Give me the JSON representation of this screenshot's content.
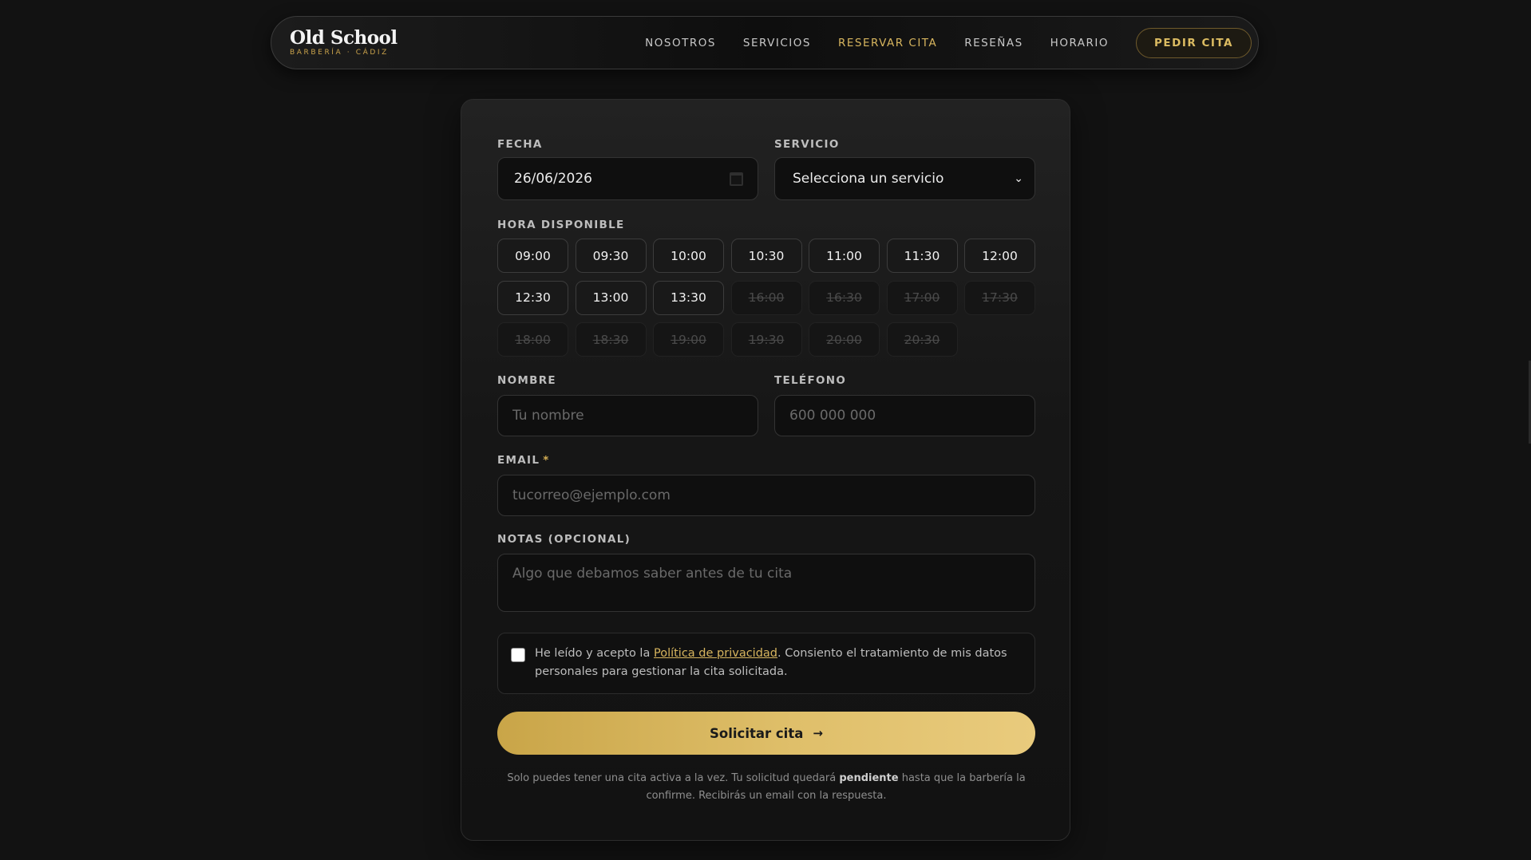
{
  "brand": {
    "name": "Old School",
    "subtitle": "BARBERÍA · CÁDIZ"
  },
  "nav": {
    "links": [
      "NOSOTROS",
      "SERVICIOS",
      "RESERVAR CITA",
      "RESEÑAS",
      "HORARIO"
    ],
    "active": "RESERVAR CITA",
    "cta": "PEDIR CITA"
  },
  "form": {
    "fecha_label": "FECHA",
    "fecha_value": "26/06/2026",
    "servicio_label": "SERVICIO",
    "servicio_value": "Selecciona un servicio",
    "hora_label": "HORA DISPONIBLE",
    "slots": [
      {
        "time": "09:00",
        "available": true
      },
      {
        "time": "09:30",
        "available": true
      },
      {
        "time": "10:00",
        "available": true
      },
      {
        "time": "10:30",
        "available": true
      },
      {
        "time": "11:00",
        "available": true
      },
      {
        "time": "11:30",
        "available": true
      },
      {
        "time": "12:00",
        "available": true
      },
      {
        "time": "12:30",
        "available": true
      },
      {
        "time": "13:00",
        "available": true
      },
      {
        "time": "13:30",
        "available": true
      },
      {
        "time": "16:00",
        "available": false
      },
      {
        "time": "16:30",
        "available": false
      },
      {
        "time": "17:00",
        "available": false
      },
      {
        "time": "17:30",
        "available": false
      },
      {
        "time": "18:00",
        "available": false
      },
      {
        "time": "18:30",
        "available": false
      },
      {
        "time": "19:00",
        "available": false
      },
      {
        "time": "19:30",
        "available": false
      },
      {
        "time": "20:00",
        "available": false
      },
      {
        "time": "20:30",
        "available": false
      }
    ],
    "nombre_label": "NOMBRE",
    "nombre_placeholder": "Tu nombre",
    "telefono_label": "TELÉFONO",
    "telefono_placeholder": "600 000 000",
    "email_label": "EMAIL",
    "email_required": "*",
    "email_placeholder": "tucorreo@ejemplo.com",
    "notas_label": "NOTAS (OPCIONAL)",
    "notas_placeholder": "Algo que debamos saber antes de tu cita",
    "consent_before": "He leído y acepto la ",
    "consent_link": "Política de privacidad",
    "consent_after": ". Consiento el tratamiento de mis datos personales para gestionar la cita solicitada.",
    "submit_label": "Solicitar cita",
    "footnote_before": "Solo puedes tener una cita activa a la vez. Tu solicitud quedará ",
    "footnote_bold": "pendiente",
    "footnote_after": " hasta que la barbería la confirme. Recibirás un email con la respuesta."
  },
  "colors": {
    "accent": "#d7b55e",
    "background": "#121212"
  }
}
